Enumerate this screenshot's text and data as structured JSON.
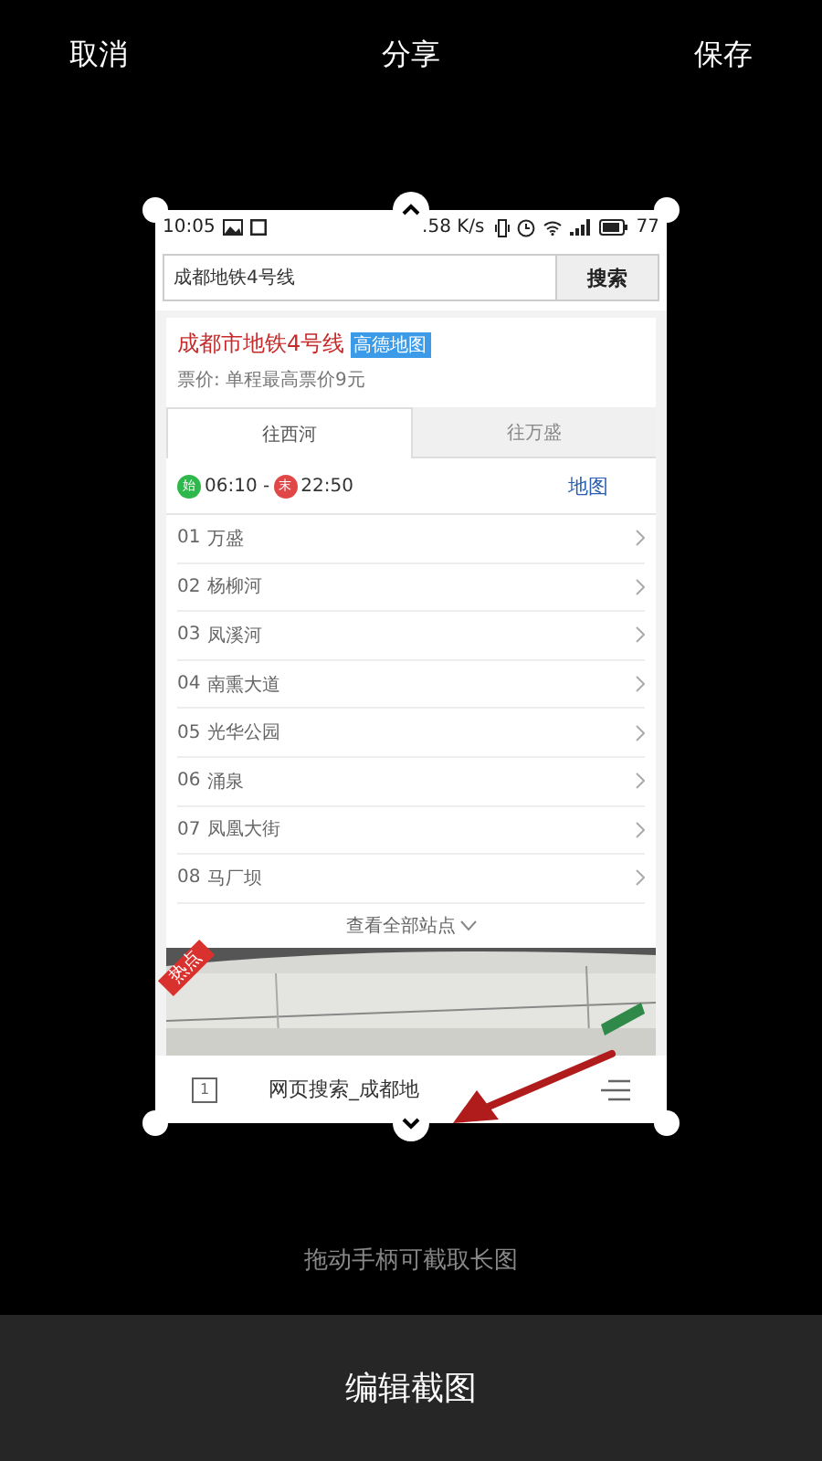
{
  "top_bar": {
    "cancel": "取消",
    "title": "分享",
    "save": "保存"
  },
  "screenshot": {
    "status_bar": {
      "time": "10:05",
      "speed": ".58 K/s",
      "battery": "77"
    },
    "search": {
      "value": "成都地铁4号线",
      "button": "搜索"
    },
    "card": {
      "title": "成都市地铁4号线",
      "tag": "高德地图",
      "fare": "票价: 单程最高票价9元"
    },
    "tabs": [
      {
        "label": "往西河",
        "selected": true
      },
      {
        "label": "往万盛",
        "selected": false
      }
    ],
    "hours": {
      "first_badge": "始",
      "first": "06:10 -",
      "last_badge": "末",
      "last": "22:50",
      "map_link": "地图"
    },
    "stations": [
      {
        "number": "01",
        "name": "万盛"
      },
      {
        "number": "02",
        "name": "杨柳河"
      },
      {
        "number": "03",
        "name": "凤溪河"
      },
      {
        "number": "04",
        "name": "南熏大道"
      },
      {
        "number": "05",
        "name": "光华公园"
      },
      {
        "number": "06",
        "name": "涌泉"
      },
      {
        "number": "07",
        "name": "凤凰大街"
      },
      {
        "number": "08",
        "name": "马厂坝"
      }
    ],
    "more": "查看全部站点",
    "hot_tag": "热点",
    "bottom_bar": {
      "tab_count": "1",
      "page_title": "网页搜索_成都地"
    }
  },
  "hint": "拖动手柄可截取长图",
  "footer": {
    "edit": "编辑截图"
  }
}
